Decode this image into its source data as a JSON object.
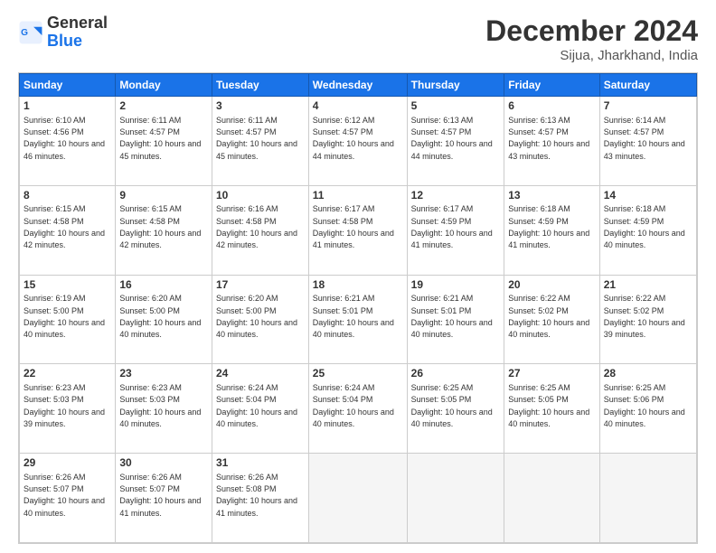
{
  "header": {
    "logo_line1": "General",
    "logo_line2": "Blue",
    "title": "December 2024",
    "subtitle": "Sijua, Jharkhand, India"
  },
  "calendar": {
    "headers": [
      "Sunday",
      "Monday",
      "Tuesday",
      "Wednesday",
      "Thursday",
      "Friday",
      "Saturday"
    ],
    "weeks": [
      [
        null,
        null,
        null,
        null,
        null,
        null,
        null
      ]
    ],
    "days": {
      "1": {
        "sunrise": "6:10 AM",
        "sunset": "4:56 PM",
        "daylight": "10 hours and 46 minutes."
      },
      "2": {
        "sunrise": "6:11 AM",
        "sunset": "4:57 PM",
        "daylight": "10 hours and 45 minutes."
      },
      "3": {
        "sunrise": "6:11 AM",
        "sunset": "4:57 PM",
        "daylight": "10 hours and 45 minutes."
      },
      "4": {
        "sunrise": "6:12 AM",
        "sunset": "4:57 PM",
        "daylight": "10 hours and 44 minutes."
      },
      "5": {
        "sunrise": "6:13 AM",
        "sunset": "4:57 PM",
        "daylight": "10 hours and 44 minutes."
      },
      "6": {
        "sunrise": "6:13 AM",
        "sunset": "4:57 PM",
        "daylight": "10 hours and 43 minutes."
      },
      "7": {
        "sunrise": "6:14 AM",
        "sunset": "4:57 PM",
        "daylight": "10 hours and 43 minutes."
      },
      "8": {
        "sunrise": "6:15 AM",
        "sunset": "4:58 PM",
        "daylight": "10 hours and 42 minutes."
      },
      "9": {
        "sunrise": "6:15 AM",
        "sunset": "4:58 PM",
        "daylight": "10 hours and 42 minutes."
      },
      "10": {
        "sunrise": "6:16 AM",
        "sunset": "4:58 PM",
        "daylight": "10 hours and 42 minutes."
      },
      "11": {
        "sunrise": "6:17 AM",
        "sunset": "4:58 PM",
        "daylight": "10 hours and 41 minutes."
      },
      "12": {
        "sunrise": "6:17 AM",
        "sunset": "4:59 PM",
        "daylight": "10 hours and 41 minutes."
      },
      "13": {
        "sunrise": "6:18 AM",
        "sunset": "4:59 PM",
        "daylight": "10 hours and 41 minutes."
      },
      "14": {
        "sunrise": "6:18 AM",
        "sunset": "4:59 PM",
        "daylight": "10 hours and 40 minutes."
      },
      "15": {
        "sunrise": "6:19 AM",
        "sunset": "5:00 PM",
        "daylight": "10 hours and 40 minutes."
      },
      "16": {
        "sunrise": "6:20 AM",
        "sunset": "5:00 PM",
        "daylight": "10 hours and 40 minutes."
      },
      "17": {
        "sunrise": "6:20 AM",
        "sunset": "5:00 PM",
        "daylight": "10 hours and 40 minutes."
      },
      "18": {
        "sunrise": "6:21 AM",
        "sunset": "5:01 PM",
        "daylight": "10 hours and 40 minutes."
      },
      "19": {
        "sunrise": "6:21 AM",
        "sunset": "5:01 PM",
        "daylight": "10 hours and 40 minutes."
      },
      "20": {
        "sunrise": "6:22 AM",
        "sunset": "5:02 PM",
        "daylight": "10 hours and 40 minutes."
      },
      "21": {
        "sunrise": "6:22 AM",
        "sunset": "5:02 PM",
        "daylight": "10 hours and 39 minutes."
      },
      "22": {
        "sunrise": "6:23 AM",
        "sunset": "5:03 PM",
        "daylight": "10 hours and 39 minutes."
      },
      "23": {
        "sunrise": "6:23 AM",
        "sunset": "5:03 PM",
        "daylight": "10 hours and 40 minutes."
      },
      "24": {
        "sunrise": "6:24 AM",
        "sunset": "5:04 PM",
        "daylight": "10 hours and 40 minutes."
      },
      "25": {
        "sunrise": "6:24 AM",
        "sunset": "5:04 PM",
        "daylight": "10 hours and 40 minutes."
      },
      "26": {
        "sunrise": "6:25 AM",
        "sunset": "5:05 PM",
        "daylight": "10 hours and 40 minutes."
      },
      "27": {
        "sunrise": "6:25 AM",
        "sunset": "5:05 PM",
        "daylight": "10 hours and 40 minutes."
      },
      "28": {
        "sunrise": "6:25 AM",
        "sunset": "5:06 PM",
        "daylight": "10 hours and 40 minutes."
      },
      "29": {
        "sunrise": "6:26 AM",
        "sunset": "5:07 PM",
        "daylight": "10 hours and 40 minutes."
      },
      "30": {
        "sunrise": "6:26 AM",
        "sunset": "5:07 PM",
        "daylight": "10 hours and 41 minutes."
      },
      "31": {
        "sunrise": "6:26 AM",
        "sunset": "5:08 PM",
        "daylight": "10 hours and 41 minutes."
      }
    }
  }
}
